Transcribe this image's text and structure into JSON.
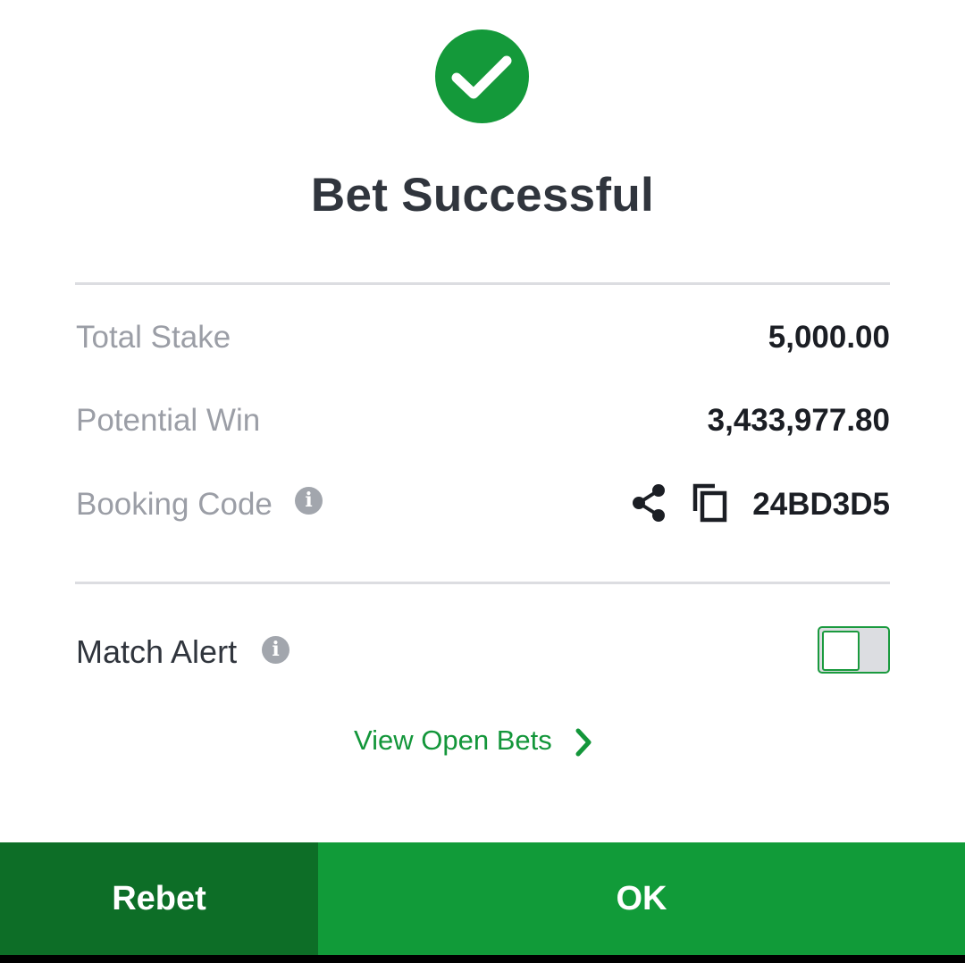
{
  "header": {
    "icon": "check-circle-icon",
    "title": "Bet Successful"
  },
  "summary": {
    "total_stake_label": "Total Stake",
    "total_stake_value": "5,000.00",
    "potential_win_label": "Potential Win",
    "potential_win_value": "3,433,977.80",
    "booking_code_label": "Booking Code",
    "booking_code_value": "24BD3D5",
    "info_icon_glyph": "i"
  },
  "match_alert": {
    "label": "Match Alert",
    "info_icon_glyph": "i",
    "enabled": false
  },
  "links": {
    "view_open_bets": "View Open Bets"
  },
  "buttons": {
    "rebet": "Rebet",
    "ok": "OK"
  },
  "colors": {
    "primary_green": "#119b39",
    "dark_green": "#0d6e27",
    "title_text": "#30353d",
    "muted_label": "#9b9ea6"
  }
}
